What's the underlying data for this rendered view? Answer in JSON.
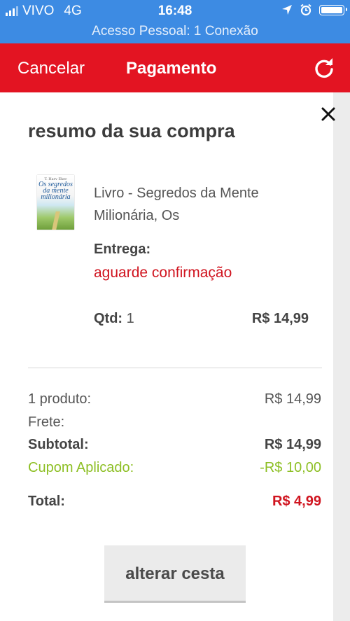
{
  "status_bar": {
    "carrier": "VIVO",
    "network": "4G",
    "time": "16:48",
    "banner": "Acesso Pessoal: 1 Conexão",
    "icons": [
      "signal-icon",
      "location-arrow-icon",
      "alarm-icon",
      "battery-icon"
    ]
  },
  "header": {
    "cancel_label": "Cancelar",
    "title": "Pagamento",
    "refresh_icon": "refresh-icon",
    "color": "#e31422"
  },
  "summary": {
    "title": "resumo da sua compra",
    "close_icon": "close-icon",
    "product": {
      "cover_author": "T. Harv Eker",
      "cover_title": "Os segredos da mente milionária",
      "name": "Livro - Segredos da Mente Milionária, Os",
      "delivery_label": "Entrega:",
      "delivery_value": "aguarde confirmação",
      "qty_label": "Qtd:",
      "qty_value": "1",
      "price": "R$ 14,99"
    },
    "totals": {
      "products_label": "1 produto:",
      "products_value": "R$ 14,99",
      "shipping_label": "Frete:",
      "shipping_value": "",
      "subtotal_label": "Subtotal:",
      "subtotal_value": "R$ 14,99",
      "coupon_label": "Cupom Aplicado:",
      "coupon_value": "-R$ 10,00",
      "total_label": "Total:",
      "total_value": "R$ 4,99"
    },
    "change_cart_label": "alterar cesta"
  },
  "colors": {
    "status_bar": "#3d8be3",
    "accent_red": "#d0141f",
    "coupon_green": "#8dbf24"
  }
}
